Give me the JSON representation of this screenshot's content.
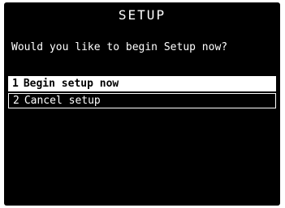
{
  "title": "SETUP",
  "prompt": "Would you like to begin Setup now?",
  "options": [
    {
      "number": "1",
      "label": "Begin setup now",
      "selected": true
    },
    {
      "number": "2",
      "label": "Cancel setup",
      "selected": false
    }
  ],
  "colors": {
    "screen_background": "#000000",
    "text": "#ffffff",
    "selection_background": "#ffffff",
    "selection_text": "#000000"
  }
}
